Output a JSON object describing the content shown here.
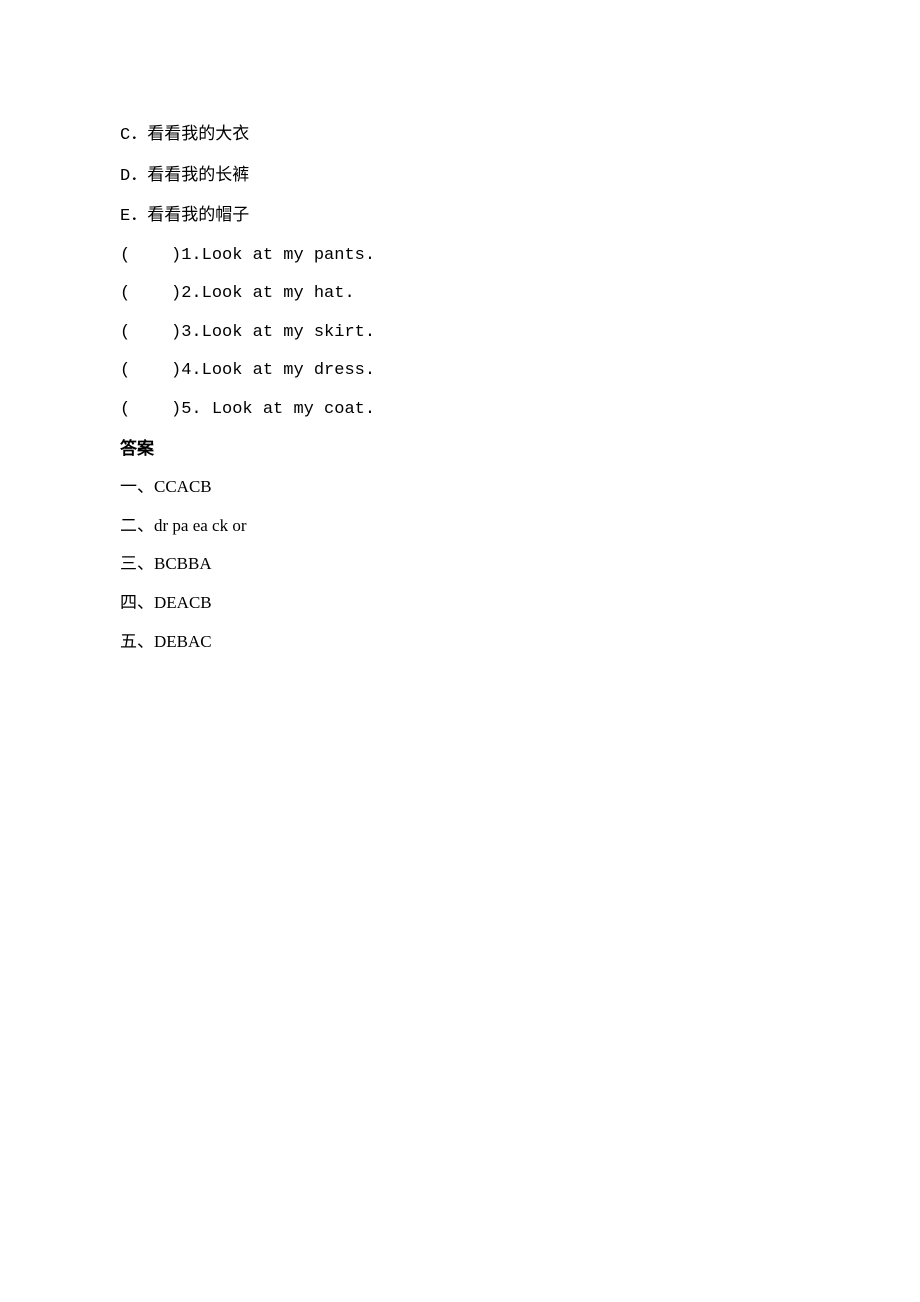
{
  "options": [
    {
      "letter": "C",
      "text": "．看看我的大衣"
    },
    {
      "letter": "D",
      "text": "．看看我的长裤"
    },
    {
      "letter": "E",
      "text": "．看看我的帽子"
    }
  ],
  "questions": [
    {
      "prefix": "(    )1.",
      "text": "Look at my pants."
    },
    {
      "prefix": "(    )2.",
      "text": "Look at my hat."
    },
    {
      "prefix": "(    )3.",
      "text": "Look at my skirt."
    },
    {
      "prefix": "(    )4.",
      "text": "Look at my dress."
    },
    {
      "prefix": "(    )5. ",
      "text": "Look at my coat."
    }
  ],
  "answers_heading": "答案",
  "answers": [
    "一、CCACB",
    "二、dr pa ea ck or",
    "三、BCBBA",
    "四、DEACB",
    "五、DEBAC"
  ]
}
